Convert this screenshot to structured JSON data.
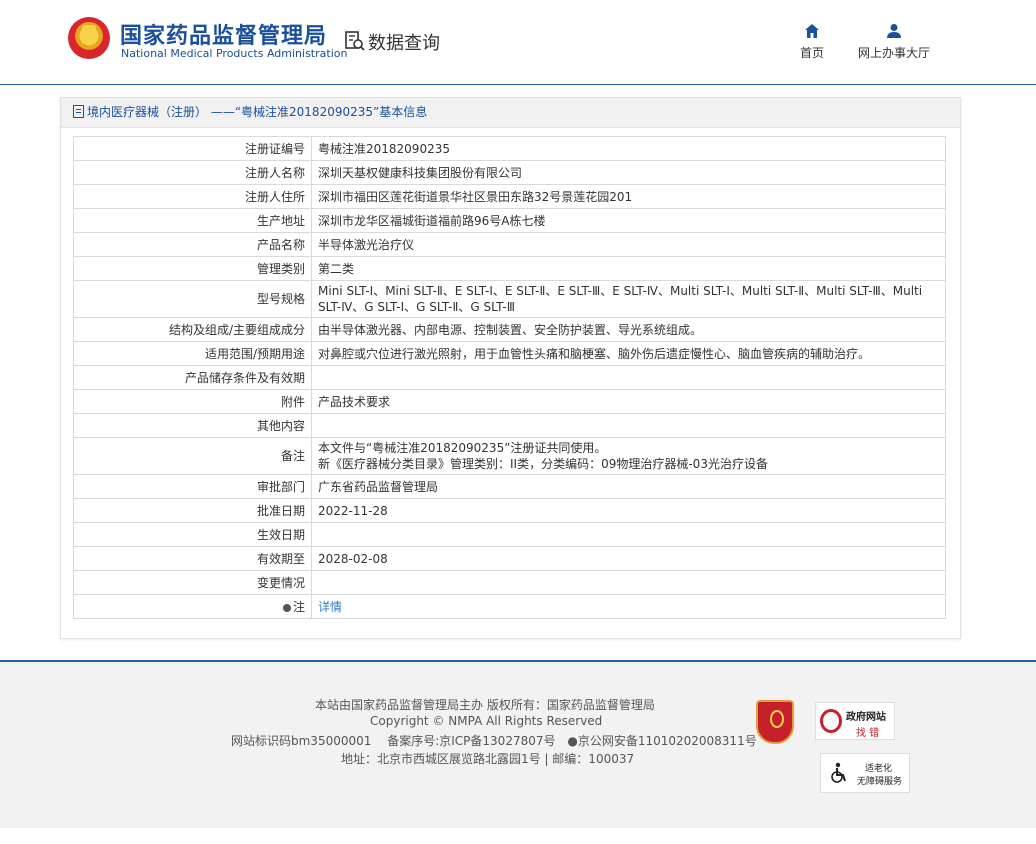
{
  "header": {
    "org_cn": "国家药品监督管理局",
    "org_en": "National Medical Products Administration",
    "page_title": "数据查询",
    "nav": [
      {
        "label": "首页",
        "icon": "home-icon"
      },
      {
        "label": "网上办事大厅",
        "icon": "user-icon"
      }
    ]
  },
  "panel": {
    "title": "境内医疗器械（注册） ——“粤械注准20182090235”基本信息"
  },
  "rows": [
    {
      "k": "注册证编号",
      "v": "粤械注准20182090235"
    },
    {
      "k": "注册人名称",
      "v": "深圳天基权健康科技集团股份有限公司"
    },
    {
      "k": "注册人住所",
      "v": "深圳市福田区莲花街道景华社区景田东路32号景莲花园201"
    },
    {
      "k": "生产地址",
      "v": "深圳市龙华区福城街道福前路96号A栋七楼"
    },
    {
      "k": "产品名称",
      "v": "半导体激光治疗仪"
    },
    {
      "k": "管理类别",
      "v": "第二类"
    },
    {
      "k": "型号规格",
      "v": "Mini SLT-Ⅰ、Mini SLT-Ⅱ、E SLT-Ⅰ、E SLT-Ⅱ、E SLT-Ⅲ、E SLT-Ⅳ、Multi SLT-Ⅰ、Multi SLT-Ⅱ、Multi SLT-Ⅲ、Multi SLT-Ⅳ、G SLT-Ⅰ、G SLT-Ⅱ、G SLT-Ⅲ"
    },
    {
      "k": "结构及组成/主要组成成分",
      "v": "由半导体激光器、内部电源、控制装置、安全防护装置、导光系统组成。"
    },
    {
      "k": "适用范围/预期用途",
      "v": "对鼻腔或穴位进行激光照射，用于血管性头痛和脑梗塞、脑外伤后遗症慢性心、脑血管疾病的辅助治疗。"
    },
    {
      "k": "产品储存条件及有效期",
      "v": ""
    },
    {
      "k": "附件",
      "v": "产品技术要求"
    },
    {
      "k": "其他内容",
      "v": ""
    },
    {
      "k": "备注",
      "v": "本文件与“粤械注准20182090235”注册证共同使用。",
      "v2": "新《医疗器械分类目录》管理类别：II类，分类编码：09物理治疗器械-03光治疗设备"
    },
    {
      "k": "审批部门",
      "v": "广东省药品监督管理局"
    },
    {
      "k": "批准日期",
      "v": "2022-11-28"
    },
    {
      "k": "生效日期",
      "v": ""
    },
    {
      "k": "有效期至",
      "v": "2028-02-08"
    },
    {
      "k": "变更情况",
      "v": ""
    },
    {
      "k": "注",
      "v": "详情"
    }
  ],
  "footer": {
    "line1": "本站由国家药品监督管理局主办 版权所有：国家药品监督管理局",
    "line2": "Copyright © NMPA All Rights Reserved",
    "line3a": "网站标识码bm35000001",
    "line3b": "备案序号:京ICP备13027807号",
    "line3c": "京公网安备11010202008311号",
    "line4": "地址：北京市西城区展览路北露园1号 | 邮编：100037",
    "badge_party": "党政机关",
    "badge_gov_1": "政府网站",
    "badge_gov_2": "找 错",
    "badge_old_1": "适老化",
    "badge_old_2": "无障碍服务"
  }
}
